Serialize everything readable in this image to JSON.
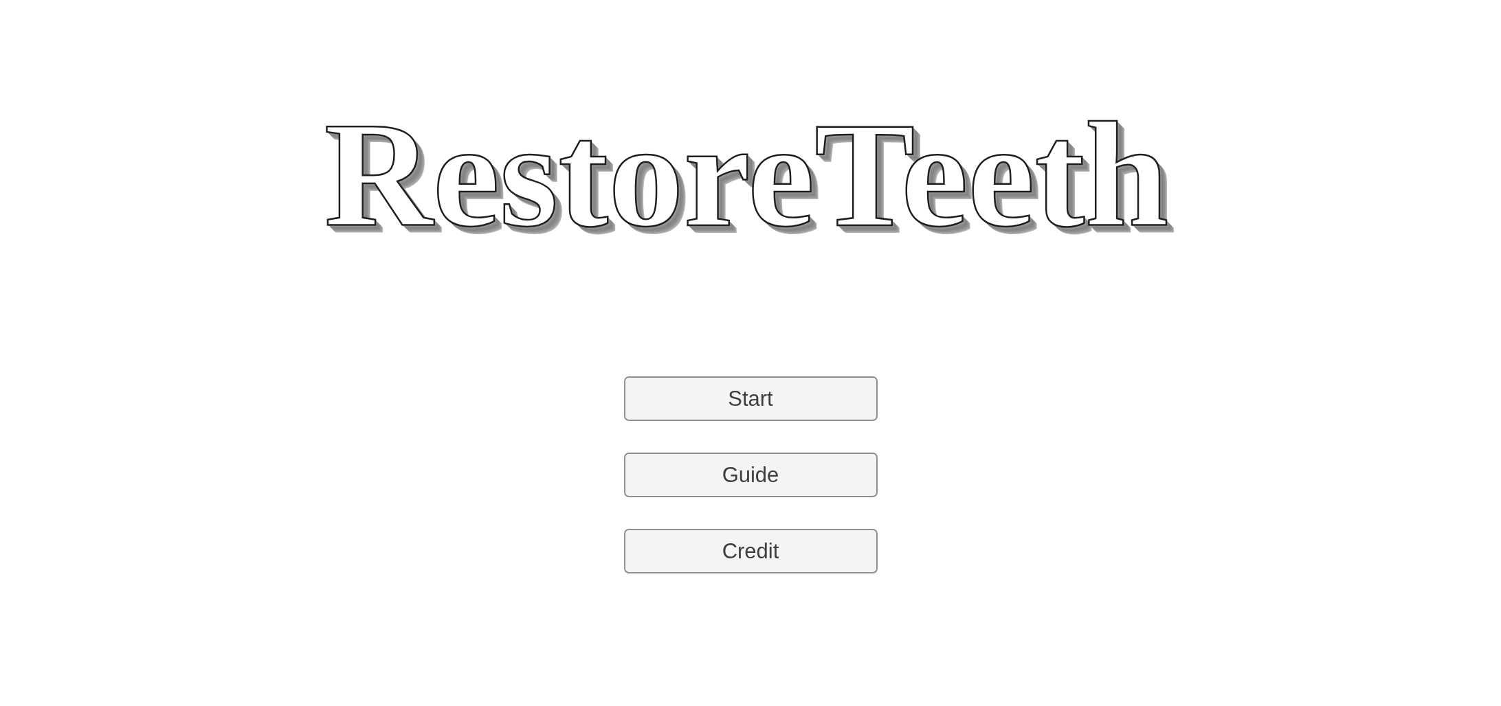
{
  "title": "RestoreTeeth",
  "menu": [
    {
      "label": "Start"
    },
    {
      "label": "Guide"
    },
    {
      "label": "Credit"
    }
  ]
}
